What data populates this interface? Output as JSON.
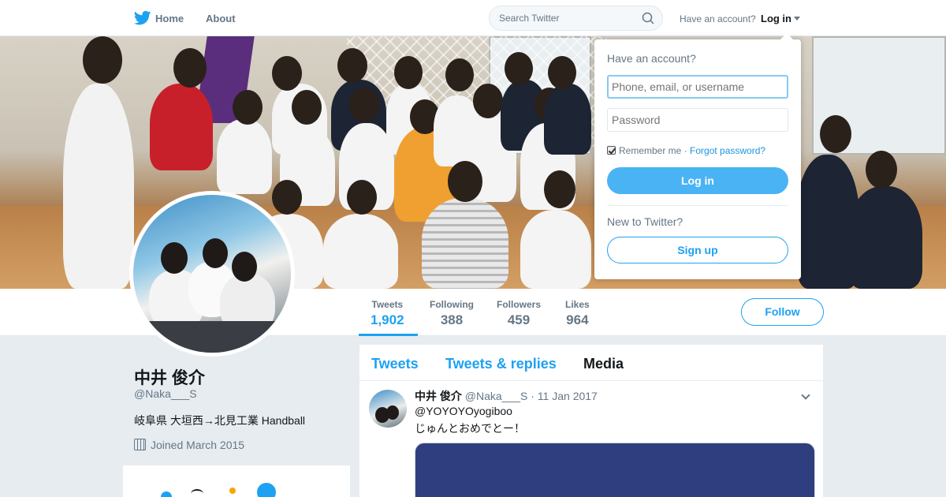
{
  "nav": {
    "home": "Home",
    "about": "About",
    "search_placeholder": "Search Twitter",
    "have_account": "Have an account?",
    "login": "Log in"
  },
  "colors": {
    "brand": "#1da1f2",
    "button": "#4ab3f4",
    "muted": "#657786"
  },
  "profile_nav": {
    "stats": [
      {
        "label": "Tweets",
        "value": "1,902"
      },
      {
        "label": "Following",
        "value": "388"
      },
      {
        "label": "Followers",
        "value": "459"
      },
      {
        "label": "Likes",
        "value": "964"
      }
    ],
    "follow": "Follow"
  },
  "profile": {
    "name": "中井 俊介",
    "handle": "@Naka___S",
    "bio": "岐阜県 大垣西→北見工業 Handball",
    "joined": "Joined March 2015"
  },
  "timeline": {
    "tabs": [
      "Tweets",
      "Tweets & replies",
      "Media"
    ],
    "tweet": {
      "name": "中井 俊介",
      "meta": "@Naka___S · 11 Jan 2017",
      "line1": "@YOYOYOyogiboo",
      "line2": "じゅんとおめでとー！"
    }
  },
  "login_dropdown": {
    "title": "Have an account?",
    "username_placeholder": "Phone, email, or username",
    "password_placeholder": "Password",
    "remember": "Remember me",
    "separator": " · ",
    "forgot": "Forgot password?",
    "login_button": "Log in",
    "new_prompt": "New to Twitter?",
    "signup_button": "Sign up"
  }
}
